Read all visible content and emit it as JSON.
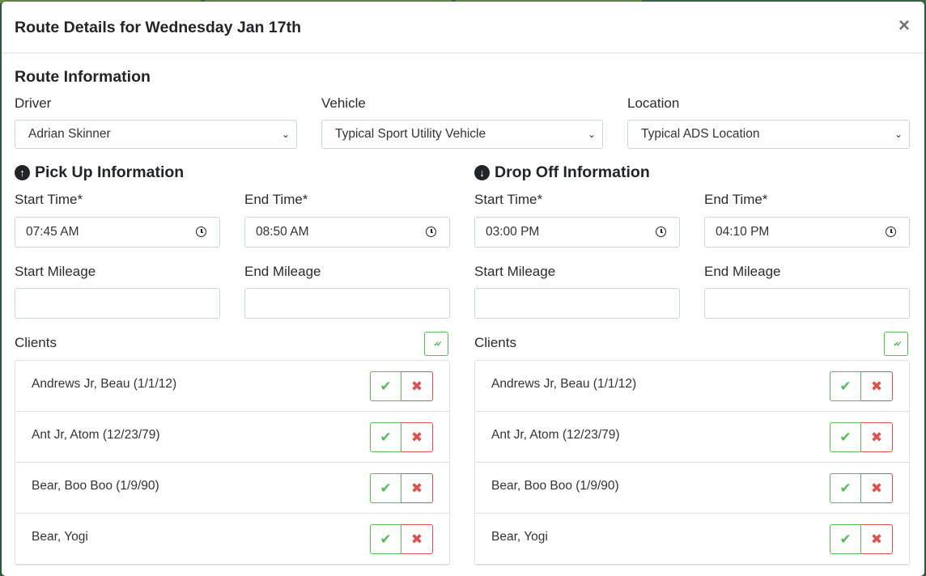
{
  "modal": {
    "title": "Route Details for Wednesday Jan 17th",
    "close_label": "×"
  },
  "route_info": {
    "title": "Route Information",
    "driver": {
      "label": "Driver",
      "value": "Adrian Skinner"
    },
    "vehicle": {
      "label": "Vehicle",
      "value": "Typical Sport Utility Vehicle"
    },
    "location": {
      "label": "Location",
      "value": "Typical ADS Location"
    }
  },
  "pickup": {
    "title": "Pick Up Information",
    "icon": "arrow-up-circle-icon",
    "start_time_label": "Start Time*",
    "start_time": "07:45 AM",
    "end_time_label": "End Time*",
    "end_time": "08:50 AM",
    "start_mileage_label": "Start Mileage",
    "end_mileage_label": "End Mileage",
    "clients_label": "Clients",
    "clients": [
      "Andrews Jr, Beau (1/1/12)",
      "Ant Jr, Atom (12/23/79)",
      "Bear, Boo Boo (1/9/90)",
      "Bear, Yogi"
    ]
  },
  "dropoff": {
    "title": "Drop Off Information",
    "icon": "arrow-down-circle-icon",
    "start_time_label": "Start Time*",
    "start_time": "03:00 PM",
    "end_time_label": "End Time*",
    "end_time": "04:10 PM",
    "start_mileage_label": "Start Mileage",
    "end_mileage_label": "End Mileage",
    "clients_label": "Clients",
    "clients": [
      "Andrews Jr, Beau (1/1/12)",
      "Ant Jr, Atom (12/23/79)",
      "Bear, Boo Boo (1/9/90)",
      "Bear, Yogi"
    ]
  },
  "icons": {
    "check": "✔",
    "times": "✖",
    "check_double": "✔✔",
    "chevron": "⌄"
  },
  "colors": {
    "success": "#5cb85c",
    "danger": "#d9534f"
  }
}
